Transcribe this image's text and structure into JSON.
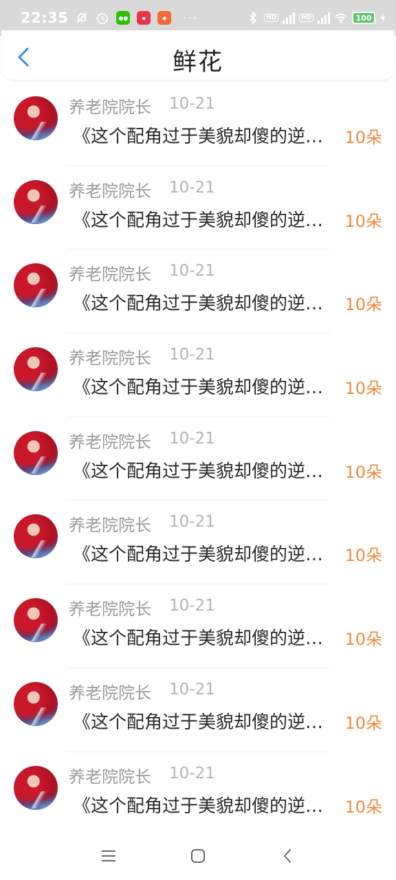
{
  "status_bar": {
    "time": "22:35",
    "left_icons": [
      "mute-bell-icon",
      "alarm-icon",
      "wechat-icon",
      "red-app-icon",
      "game-app-icon"
    ],
    "more": "···",
    "battery": "100"
  },
  "header": {
    "title": "鲜花",
    "back_icon": "back-chevron-icon"
  },
  "colors": {
    "accent": "#2f8cf0",
    "count": "#f08a3c",
    "name": "#9a9a9a",
    "text": "#2a2a2a"
  },
  "items": [
    {
      "name": "养老院院长",
      "date": "10-21",
      "message": "《这个配角过于美貌却傻的逆袭之路》",
      "count": "10朵"
    },
    {
      "name": "养老院院长",
      "date": "10-21",
      "message": "《这个配角过于美貌却傻的逆袭之路》",
      "count": "10朵"
    },
    {
      "name": "养老院院长",
      "date": "10-21",
      "message": "《这个配角过于美貌却傻的逆袭之路》",
      "count": "10朵"
    },
    {
      "name": "养老院院长",
      "date": "10-21",
      "message": "《这个配角过于美貌却傻的逆袭之路》",
      "count": "10朵"
    },
    {
      "name": "养老院院长",
      "date": "10-21",
      "message": "《这个配角过于美貌却傻的逆袭之路》",
      "count": "10朵"
    },
    {
      "name": "养老院院长",
      "date": "10-21",
      "message": "《这个配角过于美貌却傻的逆袭之路》",
      "count": "10朵"
    },
    {
      "name": "养老院院长",
      "date": "10-21",
      "message": "《这个配角过于美貌却傻的逆袭之路》",
      "count": "10朵"
    },
    {
      "name": "养老院院长",
      "date": "10-21",
      "message": "《这个配角过于美貌却傻的逆袭之路》",
      "count": "10朵"
    },
    {
      "name": "养老院院长",
      "date": "10-21",
      "message": "《这个配角过于美貌却傻的逆袭之路》",
      "count": "10朵"
    }
  ],
  "nav": {
    "menu_icon": "menu-icon",
    "home_icon": "home-icon",
    "back_icon": "back-icon"
  }
}
